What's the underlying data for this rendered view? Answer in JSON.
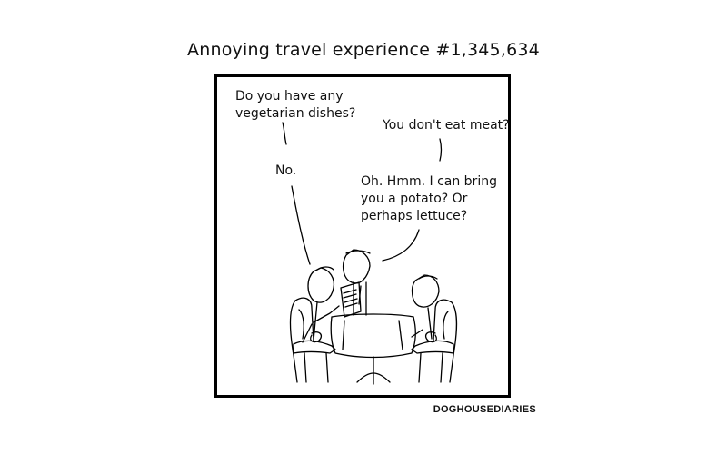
{
  "comic": {
    "title": "Annoying travel experience #1,345,634",
    "credit": "DOGHOUSEDIARIES",
    "dialogue": {
      "customer_line1": "Do you have any",
      "customer_line2": "vegetarian dishes?",
      "waiter_question": "You don't eat meat?",
      "customer_answer": "No.",
      "waiter_line1": "Oh.  Hmm.  I can bring",
      "waiter_line2": "you a potato?  Or",
      "waiter_line3": "perhaps lettuce?"
    }
  }
}
